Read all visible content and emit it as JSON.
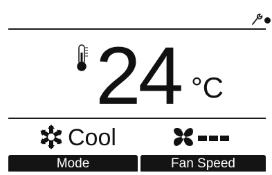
{
  "status": {
    "service_icon": "wrench-icon",
    "indicator_icon": "status-dot-icon"
  },
  "temperature": {
    "icon": "thermometer-icon",
    "value": "24",
    "unit": "°C"
  },
  "mode": {
    "icon": "snowflake-icon",
    "label": "Cool"
  },
  "fan": {
    "icon": "fan-icon",
    "level_bars": 3
  },
  "softkeys": {
    "left_label": "Mode",
    "right_label": "Fan Speed"
  },
  "colors": {
    "display_background": "#ffffff",
    "foreground": "#111111",
    "softkey_background": "#141414",
    "softkey_text": "#ffffff"
  }
}
